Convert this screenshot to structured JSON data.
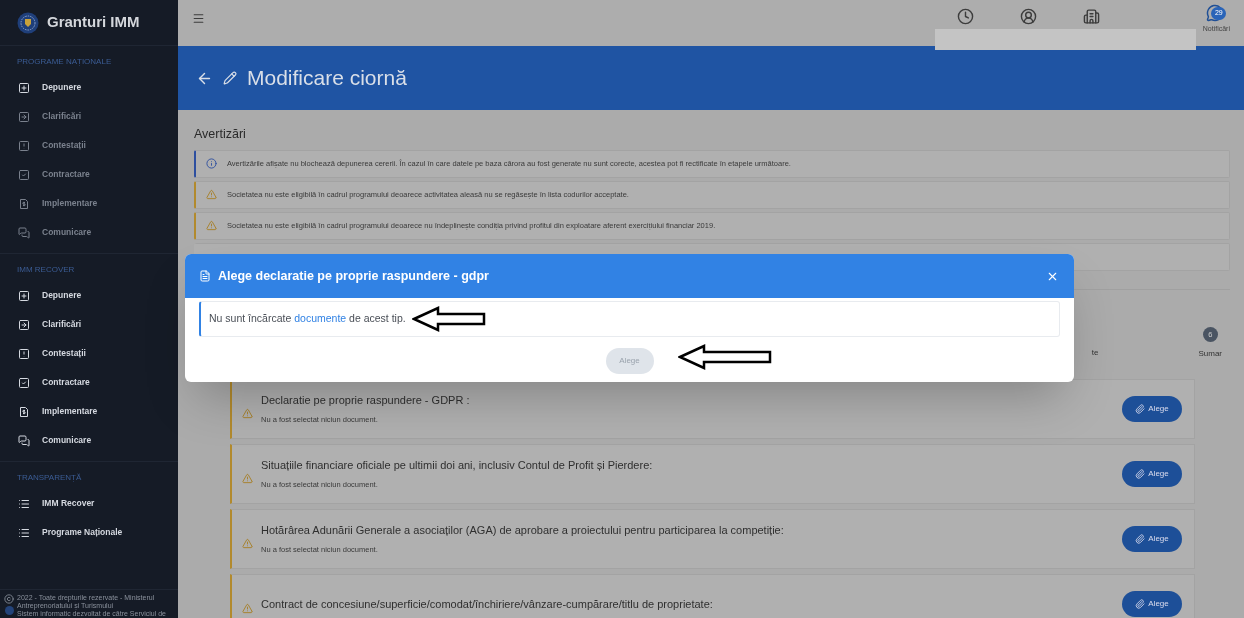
{
  "sidebar": {
    "app_title": "Granturi IMM",
    "sections": [
      {
        "title": "PROGRAME NAȚIONALE",
        "items": [
          {
            "label": "Depunere",
            "disabled": false
          },
          {
            "label": "Clarificări",
            "disabled": true
          },
          {
            "label": "Contestații",
            "disabled": true
          },
          {
            "label": "Contractare",
            "disabled": true
          },
          {
            "label": "Implementare",
            "disabled": true
          },
          {
            "label": "Comunicare",
            "disabled": true
          }
        ]
      },
      {
        "title": "IMM RECOVER",
        "items": [
          {
            "label": "Depunere",
            "disabled": false
          },
          {
            "label": "Clarificări",
            "disabled": false
          },
          {
            "label": "Contestații",
            "disabled": false
          },
          {
            "label": "Contractare",
            "disabled": false
          },
          {
            "label": "Implementare",
            "disabled": false
          },
          {
            "label": "Comunicare",
            "disabled": false
          }
        ]
      },
      {
        "title": "TRANSPARENȚĂ",
        "items": [
          {
            "label": "IMM Recover",
            "disabled": false
          },
          {
            "label": "Programe Naționale",
            "disabled": false
          }
        ]
      }
    ],
    "footer": {
      "copyright": "2022 - Toate drepturile rezervate - Ministerul Antreprenoriatului și Turismului",
      "developer": "Sistem informatic dezvoltat de către Serviciul de"
    }
  },
  "top_bar": {
    "notifications": {
      "count": "29",
      "label": "Notificări"
    }
  },
  "header": {
    "title": "Modificare ciornă"
  },
  "warnings": {
    "title": "Avertizări",
    "items": [
      {
        "kind": "info",
        "text": "Avertizările afișate nu blochează depunerea cererii. În cazul în care datele pe baza cărora au fost generate nu sunt corecte, acestea pot fi rectificate în etapele următoare."
      },
      {
        "kind": "warning",
        "text": "Societatea nu este eligibilă în cadrul programului deoarece activitatea aleasă nu se regăsește în lista codurilor acceptate."
      },
      {
        "kind": "warning",
        "text": "Societatea nu este eligibilă în cadrul programului deoarece nu îndeplinește condiția privind profitul din exploatare aferent exercițiului financiar 2019."
      },
      {
        "kind": "empty"
      }
    ]
  },
  "stepper": {
    "partial_label": "te",
    "steps": [
      {
        "number": "6",
        "label": "Sumar"
      }
    ]
  },
  "documents": [
    {
      "title": "Declaratie pe proprie raspundere - GDPR :",
      "status": "Nu a fost selectat niciun document.",
      "button": "Alege"
    },
    {
      "title": "Situațiile financiare oficiale pe ultimii doi ani, inclusiv Contul de Profit și Pierdere:",
      "status": "Nu a fost selectat niciun document.",
      "button": "Alege"
    },
    {
      "title": "Hotărârea Adunării Generale a asociaților (AGA) de aprobare a proiectului pentru participarea la competiție:",
      "status": "Nu a fost selectat niciun document.",
      "button": "Alege"
    },
    {
      "title": "Contract de concesiune/superficie/comodat/închiriere/vânzare-cumpărare/titlu de proprietate:",
      "button": "Alege"
    }
  ],
  "modal": {
    "title": "Alege declaratie pe proprie raspundere - gdpr",
    "message": {
      "before": "Nu sunt încărcate",
      "link": "documente",
      "after": "de acest tip."
    },
    "button": {
      "label": "Alege",
      "disabled": true
    }
  }
}
